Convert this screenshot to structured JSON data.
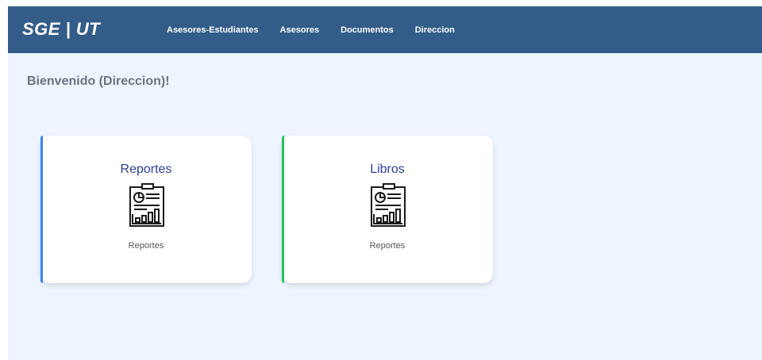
{
  "header": {
    "brand": "SGE | UT",
    "nav": [
      {
        "label": "Asesores-Estudiantes"
      },
      {
        "label": "Asesores"
      },
      {
        "label": "Documentos"
      },
      {
        "label": "Direccion"
      }
    ]
  },
  "main": {
    "welcome": "Bienvenido (Direccion)!",
    "cards": [
      {
        "title": "Reportes",
        "caption": "Reportes",
        "icon": "report-icon",
        "accent": "#3b82f6"
      },
      {
        "title": "Libros",
        "caption": "Reportes",
        "icon": "report-icon",
        "accent": "#22c55e"
      }
    ]
  },
  "colors": {
    "navbar": "#335d88",
    "background": "#eef5fe",
    "card_title": "#2d3e96"
  }
}
